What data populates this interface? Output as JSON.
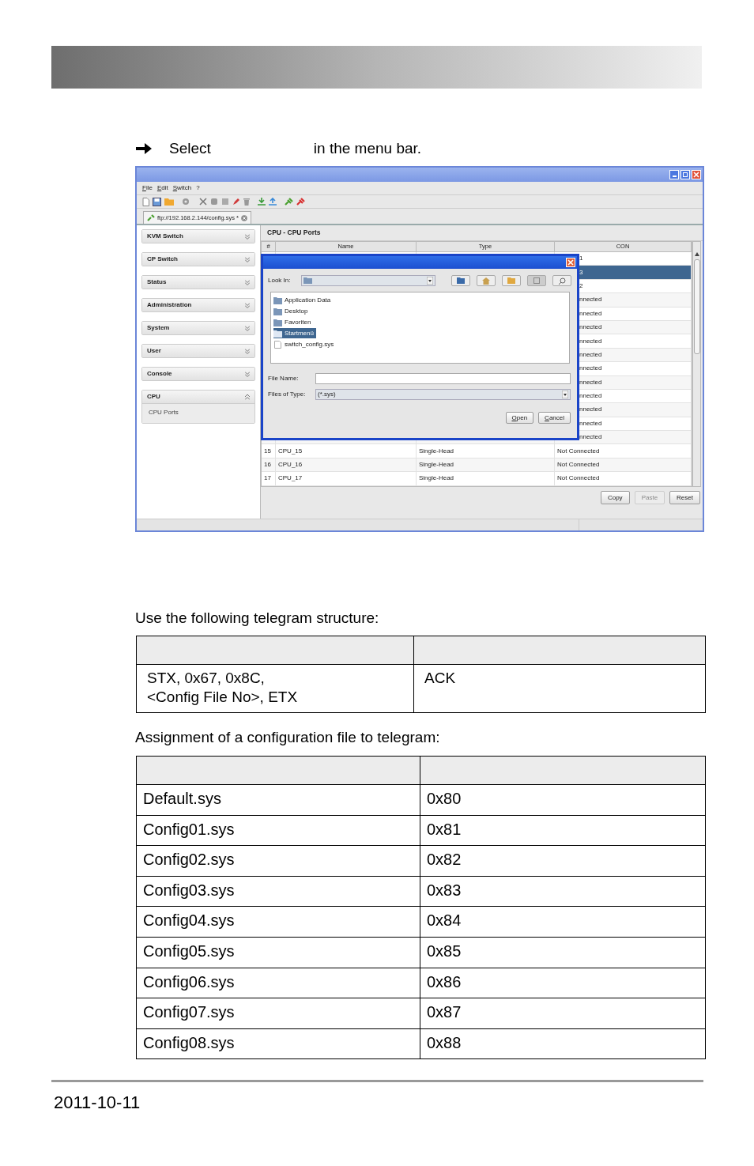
{
  "instruction": {
    "before": "Select",
    "after": "in the menu bar."
  },
  "app_window": {
    "menu": [
      "File",
      "Edit",
      "Switch",
      "?"
    ],
    "tab": {
      "label": "ftp://192.168.2.144/config.sys *"
    },
    "sidebar": [
      {
        "label": "KVM Switch",
        "expanded": false
      },
      {
        "label": "CP Switch",
        "expanded": false
      },
      {
        "label": "Status",
        "expanded": false
      },
      {
        "label": "Administration",
        "expanded": false
      },
      {
        "label": "System",
        "expanded": false
      },
      {
        "label": "User",
        "expanded": false
      },
      {
        "label": "Console",
        "expanded": false
      },
      {
        "label": "CPU",
        "expanded": true,
        "items": [
          "CPU Ports"
        ]
      }
    ],
    "panel_title": "CPU - CPU Ports",
    "table": {
      "columns": [
        "#",
        "Name",
        "Type",
        "CON"
      ],
      "rows": [
        {
          "con": "1",
          "selected": false
        },
        {
          "con": "3",
          "selected": true
        },
        {
          "con": "2",
          "selected": false
        },
        {
          "con": "nnected",
          "selected": false
        },
        {
          "con": "nnected",
          "selected": false
        },
        {
          "con": "nnected",
          "selected": false
        },
        {
          "con": "nnected",
          "selected": false
        },
        {
          "con": "nnected",
          "selected": false
        },
        {
          "con": "nnected",
          "selected": false
        },
        {
          "con": "nnected",
          "selected": false
        },
        {
          "con": "nnected",
          "selected": false
        },
        {
          "con": "nnected",
          "selected": false
        },
        {
          "con": "nnected",
          "selected": false
        },
        {
          "con": "nnected",
          "selected": false
        },
        {
          "number": "15",
          "name": "CPU_15",
          "type": "Single-Head",
          "con": "Not Connected",
          "selected": false
        },
        {
          "number": "16",
          "name": "CPU_16",
          "type": "Single-Head",
          "con": "Not Connected",
          "selected": false
        },
        {
          "number": "17",
          "name": "CPU_17",
          "type": "Single-Head",
          "con": "Not Connected",
          "selected": false
        }
      ]
    },
    "dialog": {
      "look_in_label": "Look In:",
      "files": [
        {
          "name": "Application Data",
          "kind": "folder",
          "selected": false
        },
        {
          "name": "Desktop",
          "kind": "folder",
          "selected": false
        },
        {
          "name": "Favoriten",
          "kind": "folder",
          "selected": false
        },
        {
          "name": "Startmenü",
          "kind": "folder",
          "selected": true
        },
        {
          "name": "switch_config.sys",
          "kind": "file",
          "selected": false
        }
      ],
      "file_name_label": "File Name:",
      "files_of_type_label": "Files of Type:",
      "files_of_type_value": "(*.sys)",
      "buttons": [
        "Open",
        "Cancel"
      ]
    },
    "buttons": [
      {
        "label": "Copy",
        "disabled": false
      },
      {
        "label": "Paste",
        "disabled": true
      },
      {
        "label": "Reset",
        "disabled": false
      }
    ]
  },
  "telegram_intro": "Use the following telegram structure:",
  "telegram_table": {
    "rows": [
      [
        "STX, 0x67, 0x8C,\n<Config File No>, ETX",
        "ACK"
      ]
    ]
  },
  "assignment_intro": "Assignment of a configuration file to telegram:",
  "assignment_table": {
    "rows": [
      [
        "Default.sys",
        "0x80"
      ],
      [
        "Config01.sys",
        "0x81"
      ],
      [
        "Config02.sys",
        "0x82"
      ],
      [
        "Config03.sys",
        "0x83"
      ],
      [
        "Config04.sys",
        "0x84"
      ],
      [
        "Config05.sys",
        "0x85"
      ],
      [
        "Config06.sys",
        "0x86"
      ],
      [
        "Config07.sys",
        "0x87"
      ],
      [
        "Config08.sys",
        "0x88"
      ]
    ]
  },
  "footer": {
    "date": "2011-10-11"
  }
}
